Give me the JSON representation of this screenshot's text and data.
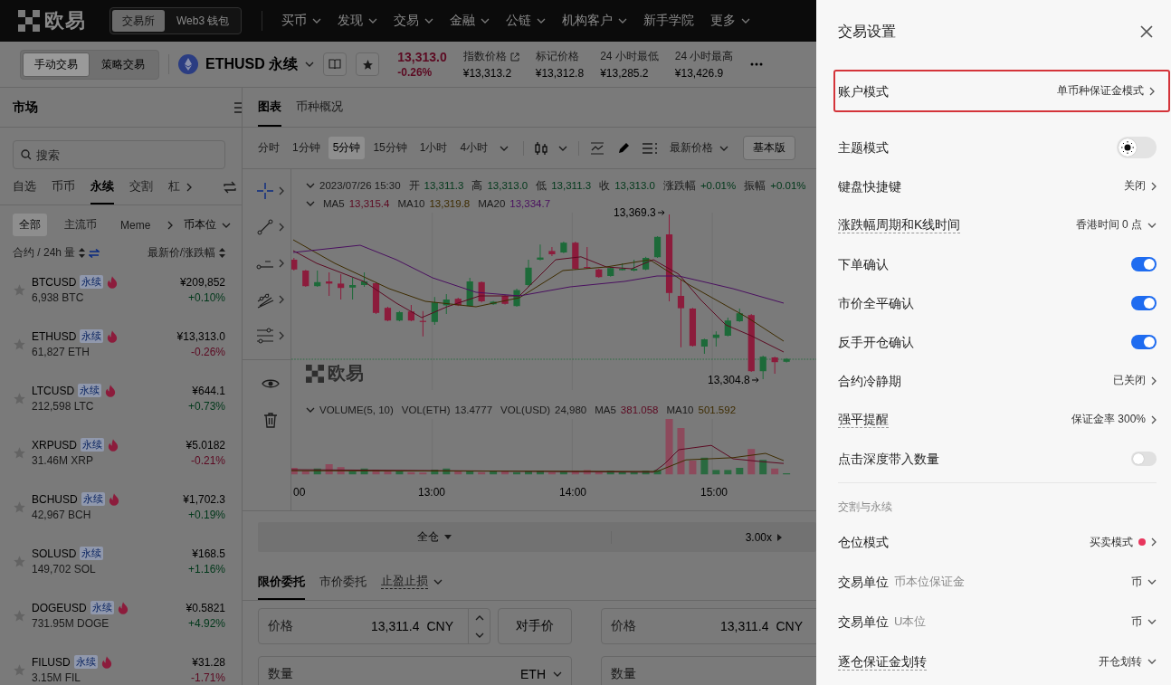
{
  "top_nav": {
    "logo": "欧易",
    "modes": [
      {
        "label": "交易所",
        "selected": true
      },
      {
        "label": "Web3 钱包",
        "selected": false
      }
    ],
    "menu": [
      {
        "label": "买币",
        "dropdown": true
      },
      {
        "label": "发现",
        "dropdown": true
      },
      {
        "label": "交易",
        "dropdown": true
      },
      {
        "label": "金融",
        "dropdown": true
      },
      {
        "label": "公链",
        "dropdown": true
      },
      {
        "label": "机构客户",
        "dropdown": true
      },
      {
        "label": "新手学院",
        "dropdown": false
      },
      {
        "label": "更多",
        "dropdown": true
      }
    ]
  },
  "instrument_bar": {
    "trade_modes": [
      {
        "label": "手动交易",
        "selected": true
      },
      {
        "label": "策略交易",
        "selected": false
      }
    ],
    "symbol": "ETHUSD 永续",
    "last_price": "13,313.0",
    "change": "-0.26%",
    "up": false,
    "stats": [
      {
        "label": "指数价格",
        "value": "¥13,313.2",
        "external_link": true
      },
      {
        "label": "标记价格",
        "value": "¥13,312.8",
        "external_link": false
      },
      {
        "label": "24 小时最低",
        "value": "¥13,285.2",
        "external_link": false
      },
      {
        "label": "24 小时最高",
        "value": "¥13,426.9",
        "external_link": false
      }
    ]
  },
  "market": {
    "title": "市场",
    "search_placeholder": "搜索",
    "tabs": [
      {
        "label": "自选",
        "selected": false
      },
      {
        "label": "币币",
        "selected": false
      },
      {
        "label": "永续",
        "selected": true
      },
      {
        "label": "交割",
        "selected": false
      },
      {
        "label": "杠",
        "selected": false
      }
    ],
    "filters": [
      {
        "label": "全部",
        "selected": true
      },
      {
        "label": "主流币",
        "selected": false
      },
      {
        "label": "Meme",
        "selected": false
      }
    ],
    "quote_unit": "币本位",
    "sort_volume": "合约 / 24h 量",
    "sort_price": "最新价/涨跌幅",
    "rows": [
      {
        "symbol": "BTCUSD",
        "tag": "永续",
        "hot": true,
        "volume": "6,938 BTC",
        "price": "¥209,852",
        "change": "+0.10%",
        "up": true
      },
      {
        "symbol": "ETHUSD",
        "tag": "永续",
        "hot": true,
        "volume": "61,827 ETH",
        "price": "¥13,313.0",
        "change": "-0.26%",
        "up": false
      },
      {
        "symbol": "LTCUSD",
        "tag": "永续",
        "hot": true,
        "volume": "212,598 LTC",
        "price": "¥644.1",
        "change": "+0.73%",
        "up": true
      },
      {
        "symbol": "XRPUSD",
        "tag": "永续",
        "hot": true,
        "volume": "31.46M XRP",
        "price": "¥5.0182",
        "change": "-0.21%",
        "up": false
      },
      {
        "symbol": "BCHUSD",
        "tag": "永续",
        "hot": true,
        "volume": "42,967 BCH",
        "price": "¥1,702.3",
        "change": "+0.19%",
        "up": true
      },
      {
        "symbol": "SOLUSD",
        "tag": "永续",
        "hot": false,
        "volume": "149,702 SOL",
        "price": "¥168.5",
        "change": "+1.16%",
        "up": true
      },
      {
        "symbol": "DOGEUSD",
        "tag": "永续",
        "hot": true,
        "volume": "731.95M DOGE",
        "price": "¥0.5821",
        "change": "+4.92%",
        "up": true
      },
      {
        "symbol": "FILUSD",
        "tag": "永续",
        "hot": true,
        "volume": "3.15M FIL",
        "price": "¥31.28",
        "change": "-1.71%",
        "up": false
      }
    ]
  },
  "chart": {
    "tabs": [
      {
        "label": "图表",
        "selected": true
      },
      {
        "label": "币种概况",
        "selected": false
      }
    ],
    "intervals": [
      {
        "label": "分时",
        "selected": false
      },
      {
        "label": "1分钟",
        "selected": false
      },
      {
        "label": "5分钟",
        "selected": true
      },
      {
        "label": "15分钟",
        "selected": false
      },
      {
        "label": "1小时",
        "selected": false
      },
      {
        "label": "4小时",
        "selected": false
      }
    ],
    "price_source": "最新价格",
    "view_mode": "基本版",
    "ohlc": {
      "datetime": "2023/07/26 15:30",
      "up": true,
      "fields": [
        {
          "label": "开",
          "value": "13,311.3"
        },
        {
          "label": "高",
          "value": "13,313.0"
        },
        {
          "label": "低",
          "value": "13,311.3"
        },
        {
          "label": "收",
          "value": "13,313.0"
        },
        {
          "label": "涨跌幅",
          "value": "+0.01%"
        },
        {
          "label": "振幅",
          "value": "+0.01%"
        }
      ]
    },
    "ma": [
      {
        "label": "MA5",
        "value": "13,315.4",
        "color": "#5c0a22"
      },
      {
        "label": "MA10",
        "value": "13,319.8",
        "color": "#3e2c00"
      },
      {
        "label": "MA20",
        "value": "13,334.7",
        "color": "#4a1060"
      }
    ],
    "high_label": "13,369.3",
    "low_label": "13,304.8",
    "watermark": "欧易",
    "volume": {
      "title": "VOLUME(5, 10)",
      "fields": [
        {
          "label": "VOL(ETH)",
          "value": "13.4777"
        },
        {
          "label": "VOL(USD)",
          "value": "24,980"
        }
      ],
      "ma": [
        {
          "label": "MA5",
          "value": "381.058",
          "color": "#5c0a22"
        },
        {
          "label": "MA10",
          "value": "501.592",
          "color": "#3e2c00"
        }
      ]
    },
    "time_labels": [
      "00",
      "13:00",
      "14:00",
      "15:00"
    ]
  },
  "order": {
    "margin_mode": "全仓",
    "leverage": "3.00x",
    "tabs": [
      {
        "label": "限价委托",
        "selected": true
      },
      {
        "label": "市价委托",
        "selected": false
      },
      {
        "label": "止盈止损",
        "selected": false
      }
    ],
    "buy_form": {
      "price_label": "价格",
      "price": "13,311.4",
      "price_unit": "CNY",
      "counter_price": "对手价",
      "quantity_label": "数量",
      "quantity_unit": "ETH"
    },
    "sell_form": {
      "price_label": "价格",
      "price": "13,311.4",
      "price_unit": "CNY",
      "quantity_label": "数量"
    }
  },
  "settings_drawer": {
    "title": "交易设置",
    "sections": [
      {
        "rows": [
          {
            "kind": "link",
            "label": "账户模式",
            "value": "单币种保证金模式",
            "highlighted": true,
            "hint": false,
            "badge": false
          },
          {
            "kind": "theme",
            "label": "主题模式",
            "on": false,
            "highlighted": false,
            "hint": false
          },
          {
            "kind": "link",
            "label": "键盘快捷键",
            "value": "关闭",
            "highlighted": false,
            "hint": false,
            "badge": false
          },
          {
            "kind": "dropdown",
            "label": "涨跌幅周期和K线时间",
            "value": "香港时间 0 点",
            "highlighted": false,
            "hint": true
          },
          {
            "kind": "toggle",
            "label": "下单确认",
            "on": true,
            "highlighted": false,
            "hint": false
          },
          {
            "kind": "toggle",
            "label": "市价全平确认",
            "on": true,
            "highlighted": false,
            "hint": false
          },
          {
            "kind": "toggle",
            "label": "反手开仓确认",
            "on": true,
            "highlighted": false,
            "hint": false
          },
          {
            "kind": "link",
            "label": "合约冷静期",
            "value": "已关闭",
            "highlighted": false,
            "hint": false,
            "badge": false
          },
          {
            "kind": "link",
            "label": "强平提醒",
            "value": "保证金率 300%",
            "highlighted": false,
            "hint": true,
            "badge": false
          },
          {
            "kind": "toggle",
            "label": "点击深度带入数量",
            "on": false,
            "highlighted": false,
            "hint": false
          }
        ]
      },
      {
        "title": "交割与永续",
        "rows": [
          {
            "kind": "link",
            "label": "仓位模式",
            "value": "买卖模式",
            "highlighted": false,
            "hint": false,
            "badge": true
          },
          {
            "kind": "dropdown",
            "label": "交易单位",
            "sublabel": "币本位保证金",
            "value": "币",
            "highlighted": false,
            "hint": false
          },
          {
            "kind": "dropdown",
            "label": "交易单位",
            "sublabel": "U本位",
            "value": "币",
            "highlighted": false,
            "hint": false
          },
          {
            "kind": "dropdown",
            "label": "逐仓保证金划转",
            "value": "开仓划转",
            "highlighted": false,
            "hint": true
          }
        ]
      }
    ]
  }
}
